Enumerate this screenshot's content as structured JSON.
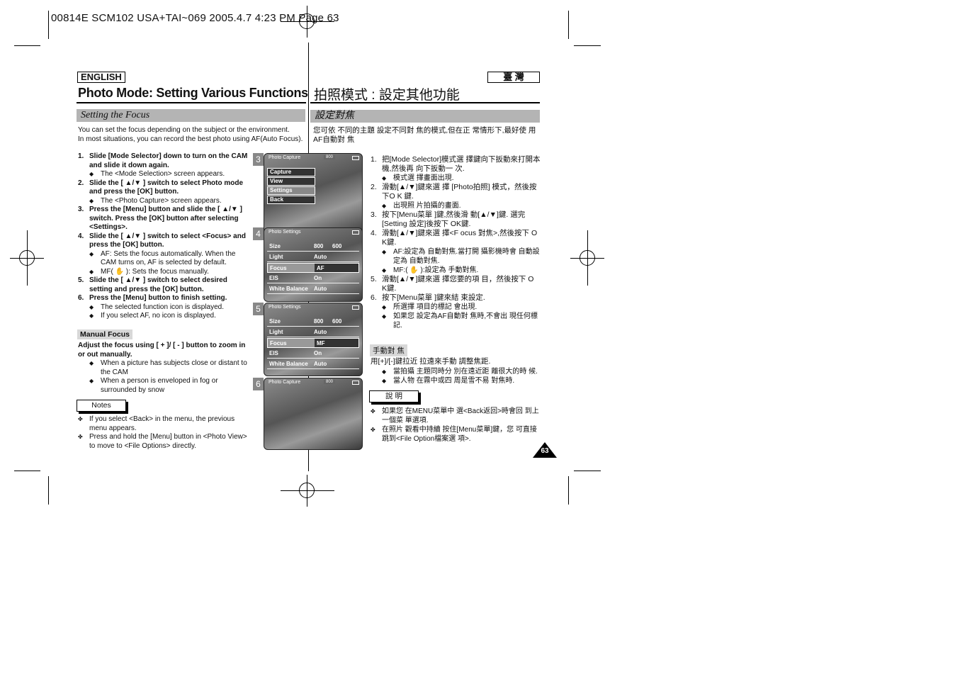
{
  "print_header": "00814E SCM102 USA+TAI~069 2005.4.7 4:23 PM Page 63",
  "english": {
    "lang_label": "ENGLISH",
    "title": "Photo Mode: Setting Various Functions",
    "section": "Setting the Focus",
    "intro": [
      "You can set the focus depending on the subject or the environment.",
      "In most situations, you can record the best photo using AF(Auto Focus)."
    ],
    "steps": [
      {
        "n": "1.",
        "text": "Slide [Mode Selector] down to turn on the CAM and slide it down again.",
        "subs": [
          "The <Mode Selection> screen appears."
        ]
      },
      {
        "n": "2.",
        "text": "Slide the [ ▲/▼ ] switch to select Photo mode and press the [OK] button.",
        "subs": [
          "The <Photo Capture> screen appears."
        ]
      },
      {
        "n": "3.",
        "text": "Press the [Menu] button and slide the [ ▲/▼ ] switch. Press the [OK] button after selecting <Settings>.",
        "subs": []
      },
      {
        "n": "4.",
        "text": "Slide the [ ▲/▼ ] switch to select <Focus> and press the [OK] button.",
        "subs": [
          "AF: Sets the focus automatically. When the CAM turns on, AF is selected by default.",
          "MF( ✋ ): Sets the focus manually."
        ]
      },
      {
        "n": "5.",
        "text": "Slide the [ ▲/▼ ] switch to select desired setting and press the [OK] button.",
        "subs": []
      },
      {
        "n": "6.",
        "text": "Press the [Menu] button to finish setting.",
        "subs": [
          "The selected function icon is displayed.",
          "If you select  AF, no icon is displayed."
        ]
      }
    ],
    "manual_focus": {
      "label": "Manual Focus",
      "text": "Adjust the focus using [ + ]/ [ - ] button to zoom in or out manually.",
      "subs": [
        "When a picture has subjects close or distant to the CAM",
        "When a person is enveloped in fog or surrounded by snow"
      ]
    },
    "notes": {
      "label": "Notes",
      "items": [
        "If you select <Back> in the menu, the previous menu appears.",
        "Press and hold the [Menu] button in <Photo View> to move to <File Options> directly."
      ]
    }
  },
  "screens": [
    {
      "n": "3",
      "title": "Photo Capture",
      "badge": "800",
      "menu": [
        "Capture",
        "View",
        "Settings",
        "Back"
      ],
      "selected": 2
    },
    {
      "n": "4",
      "title": "Photo Settings",
      "rows": [
        [
          "Size",
          "800",
          "600"
        ],
        [
          "Light",
          "Auto",
          ""
        ],
        [
          "Focus",
          "AF",
          ""
        ],
        [
          "EIS",
          "On",
          ""
        ],
        [
          "White Balance",
          "Auto",
          ""
        ]
      ],
      "selected": 2
    },
    {
      "n": "5",
      "title": "Photo Settings",
      "rows": [
        [
          "Size",
          "800",
          "600"
        ],
        [
          "Light",
          "Auto",
          ""
        ],
        [
          "Focus",
          "MF",
          ""
        ],
        [
          "EIS",
          "On",
          ""
        ],
        [
          "White Balance",
          "Auto",
          ""
        ]
      ],
      "selected": 2
    },
    {
      "n": "6",
      "title": "Photo Capture",
      "badge": "800"
    }
  ],
  "chinese": {
    "lang_label": "臺 灣",
    "title": "拍照模式 : 設定其他功能",
    "section": "設定對焦",
    "intro": "您可依 不同的主題 設定不同對 焦的模式,但在正 常情形下,最好使 用AF自動對 焦",
    "steps": [
      {
        "n": "1.",
        "text": "把[Mode Selector]模式選 擇鍵向下扳動來打開本機,然後再 向下扳動一 次.",
        "subs": [
          "模式選 擇畫面出現."
        ]
      },
      {
        "n": "2.",
        "text": "滑動[▲/▼]鍵來選 擇 [Photo拍照] 模式，然後按下O K 鍵.",
        "subs": [
          "出現照 片拍攝的畫面."
        ]
      },
      {
        "n": "3.",
        "text": "按下[Menu菜單 ]鍵,然後滑 動[▲/▼]鍵. 選完[Setting 設定]後按下 OK鍵.",
        "subs": []
      },
      {
        "n": "4.",
        "text": "滑動[▲/▼]鍵來選 擇<F ocus 對焦>,然後按下 O K鍵.",
        "subs": [
          "AF:設定為 自動對焦.當打開 攝影機時會 自動設定為 自動對焦.",
          "MF:( ✋ ):設定為 手動對焦."
        ]
      },
      {
        "n": "5.",
        "text": "滑動[▲/▼]鍵來選 擇您要的項 目，然後按下 O K鍵.",
        "subs": []
      },
      {
        "n": "6.",
        "text": "按下[Menu菜單 ]鍵來結 束設定.",
        "subs": [
          "所選擇 項目的標記 會出現.",
          "如果您 設定為AF自動對 焦時,不會出 現任何標記."
        ]
      }
    ],
    "manual_focus": {
      "label": "手動對 焦",
      "text": "用[+]/[-]鍵拉近 拉遠來手動 調整焦距.",
      "subs": [
        "當拍攝 主題同時分 別在遠近距 離很大的時 候.",
        "當人物 在霧中或四 周是雪不易 對焦時."
      ]
    },
    "notes": {
      "label": "說 明",
      "items": [
        "如果您 在MENU菜單中 選<Back返回>時會回 到上一個菜 單選項.",
        "在照片 觀看中持續 按住[Menu菜單]鍵，您 可直接跳到<File Option檔案選 項>."
      ]
    }
  },
  "page_number": "63"
}
